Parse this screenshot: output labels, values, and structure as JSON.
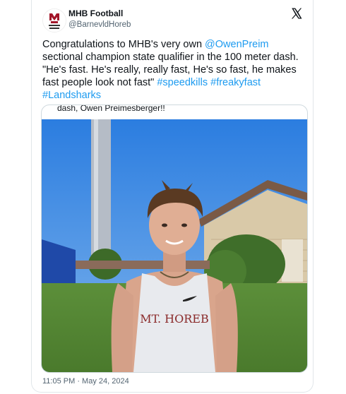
{
  "account": {
    "name": "MHB Football",
    "handle": "@BarneveldHoreb",
    "handle_display": "@BarnevldHoreb"
  },
  "tweet": {
    "text_part1": "Congratulations to MHB's very own ",
    "mention": "@OwenPreim",
    "text_part2": " sectional champion state qualifier in the 100 meter dash. \"He's fast. He's really, really fast, He's so fast, he makes fast people look not fast\" ",
    "hashtag1": "#speedkills",
    "hashtag2": "#freakyfast",
    "hashtag3": "#Landsharks"
  },
  "media": {
    "caption": "dash, Owen Preimesberger!!",
    "shirt_text": "MT. HOREB"
  },
  "meta": {
    "timestamp": "11:05 PM · May 24, 2024"
  },
  "icons": {
    "brand": "x-logo-icon",
    "avatar": "team-logo-icon"
  },
  "colors": {
    "link": "#1d9bf0",
    "text": "#0f1419",
    "muted": "#536471"
  }
}
